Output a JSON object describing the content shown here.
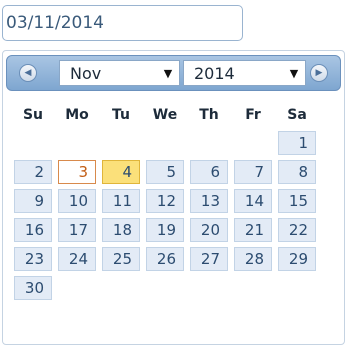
{
  "date_input": {
    "value": "03/11/2014"
  },
  "header": {
    "prev_icon": "chevron-left-icon",
    "next_icon": "chevron-right-icon",
    "month": "Nov",
    "year": "2014",
    "dropdown_icon": "triangle-down-icon"
  },
  "weekdays": [
    "Su",
    "Mo",
    "Tu",
    "We",
    "Th",
    "Fr",
    "Sa"
  ],
  "weeks": [
    [
      "",
      "",
      "",
      "",
      "",
      "",
      "1"
    ],
    [
      "2",
      "3",
      "4",
      "5",
      "6",
      "7",
      "8"
    ],
    [
      "9",
      "10",
      "11",
      "12",
      "13",
      "14",
      "15"
    ],
    [
      "16",
      "17",
      "18",
      "19",
      "20",
      "21",
      "22"
    ],
    [
      "23",
      "24",
      "25",
      "26",
      "27",
      "28",
      "29"
    ],
    [
      "30",
      "",
      "",
      "",
      "",
      "",
      ""
    ]
  ],
  "today_day": "3",
  "selected_day": "4",
  "colors": {
    "header_gradient_top": "#a9c5e3",
    "header_gradient_bottom": "#7ea6d0",
    "day_bg": "#e3ebf6",
    "selected_bg": "#fbe07a",
    "today_text": "#c25e16"
  }
}
